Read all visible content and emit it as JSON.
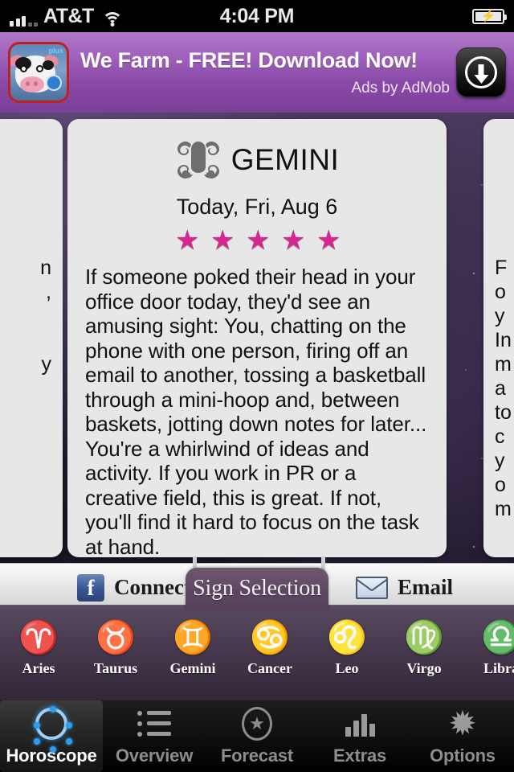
{
  "status_bar": {
    "carrier": "AT&T",
    "time": "4:04 PM",
    "signal_icon": "signal-bars-icon",
    "wifi_icon": "wifi-icon",
    "battery_icon": "battery-charging-icon"
  },
  "ad": {
    "title": "We Farm - FREE! Download Now!",
    "attribution": "Ads by AdMob",
    "app_icon": "we-farm-cow-app-icon",
    "download_icon": "download-arrow-icon",
    "bg_top": "#b278c9",
    "bg_bottom": "#7b3f98"
  },
  "card": {
    "sign": "GEMINI",
    "sign_glyph": "gemini-twins-icon",
    "date": "Today, Fri, Aug 6",
    "rating_stars": 5,
    "star_color": "#d6268f",
    "body": "If someone poked their head in your office door today, they'd see an amusing sight: You, chatting on the phone with one person, firing off an email to another, tossing a basketball through a mini-hoop and, between baskets, jotting down notes for later... You're a whirlwind of ideas and activity. If you work in PR or a creative field, this is great. If not, you'll find it hard to focus on the task at hand."
  },
  "side_cards": {
    "left_fragment": "n\n,\n\n\ny",
    "right_fragment": "F\no\ny\nIn\nm\na\nto\nc\ny\no\nm"
  },
  "social_bar": {
    "facebook_label": "Connect",
    "facebook_icon": "facebook-icon",
    "email_label": "Email",
    "email_icon": "envelope-icon"
  },
  "sign_selection": {
    "handle_label": "Sign Selection",
    "signs": [
      {
        "label": "Aries",
        "glyph": "♈",
        "icon": "aries-ram-icon"
      },
      {
        "label": "Taurus",
        "glyph": "♉",
        "icon": "taurus-bull-icon"
      },
      {
        "label": "Gemini",
        "glyph": "♊",
        "icon": "gemini-twins-icon"
      },
      {
        "label": "Cancer",
        "glyph": "♋",
        "icon": "cancer-crab-icon"
      },
      {
        "label": "Leo",
        "glyph": "♌",
        "icon": "leo-lion-icon"
      },
      {
        "label": "Virgo",
        "glyph": "♍",
        "icon": "virgo-icon"
      },
      {
        "label": "Libra",
        "glyph": "♎",
        "icon": "libra-scales-icon"
      }
    ]
  },
  "tab_bar": {
    "active": "Horoscope",
    "tabs": [
      {
        "label": "Horoscope",
        "icon": "zodiac-wheel-icon"
      },
      {
        "label": "Overview",
        "icon": "bullet-list-icon"
      },
      {
        "label": "Forecast",
        "icon": "star-circle-icon"
      },
      {
        "label": "Extras",
        "icon": "bar-chart-icon"
      },
      {
        "label": "Options",
        "icon": "star-burst-icon"
      }
    ]
  }
}
